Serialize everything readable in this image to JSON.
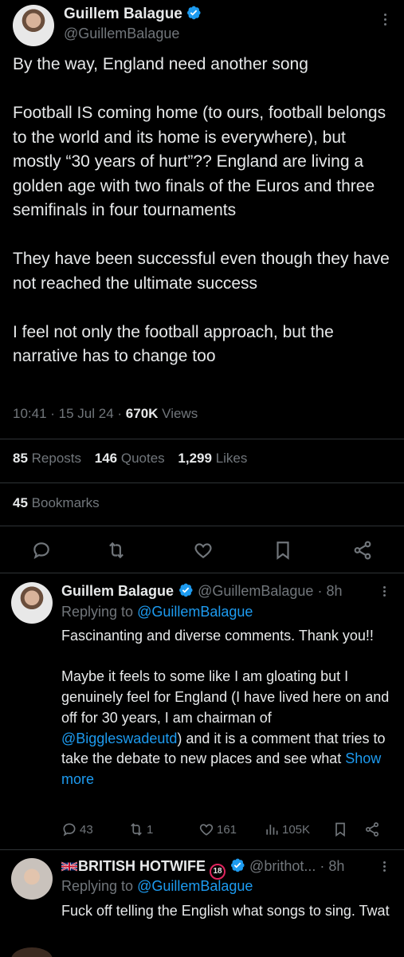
{
  "main_tweet": {
    "author_name": "Guillem Balague",
    "author_handle": "@GuillemBalague",
    "text": "By the way, England need another song\n\nFootball IS coming home (to ours, football belongs to the world and its home is everywhere), but mostly “30 years of hurt”?? England are living a golden age with two finals of the Euros and three semifinals in four tournaments\n\nThey have been successful even though they have not reached the ultimate success\n\nI feel not only the football approach, but the narrative has to change too",
    "time": "10:41",
    "date": "15 Jul 24",
    "views_count": "670K",
    "views_label": "Views",
    "reposts_count": "85",
    "reposts_label": "Reposts",
    "quotes_count": "146",
    "quotes_label": "Quotes",
    "likes_count": "1,299",
    "likes_label": "Likes",
    "bookmarks_count": "45",
    "bookmarks_label": "Bookmarks"
  },
  "replies": [
    {
      "author_name": "Guillem Balague",
      "author_handle": "@GuillemBalague",
      "age": "8h",
      "replying_prefix": "Replying to",
      "replying_to": "@GuillemBalague",
      "text_before_link": "Fascinanting and diverse comments. Thank you!!\n\nMaybe it feels to some like I am gloating but I genuinely feel for England (I have lived here on and off for 30 years, I am chairman of ",
      "mention": "@Biggleswadeutd",
      "text_after_link": ") and it is a comment that tries to take the debate to new places and see what ",
      "show_more": "Show more",
      "replies_count": "43",
      "reposts_count": "1",
      "likes_count": "161",
      "views_count": "105K"
    },
    {
      "author_name": "BRITISH HOTWIFE",
      "author_handle": "@brithot...",
      "age": "8h",
      "badge_text": "18",
      "replying_prefix": "Replying to",
      "replying_to": "@GuillemBalague",
      "text": "Fuck off telling the English what songs to sing. Twat"
    }
  ],
  "colors": {
    "background": "#000000",
    "text": "#e7e9ea",
    "muted": "#71767b",
    "link": "#1d9bf0",
    "divider": "#2f3336",
    "verified": "#1d9bf0"
  }
}
